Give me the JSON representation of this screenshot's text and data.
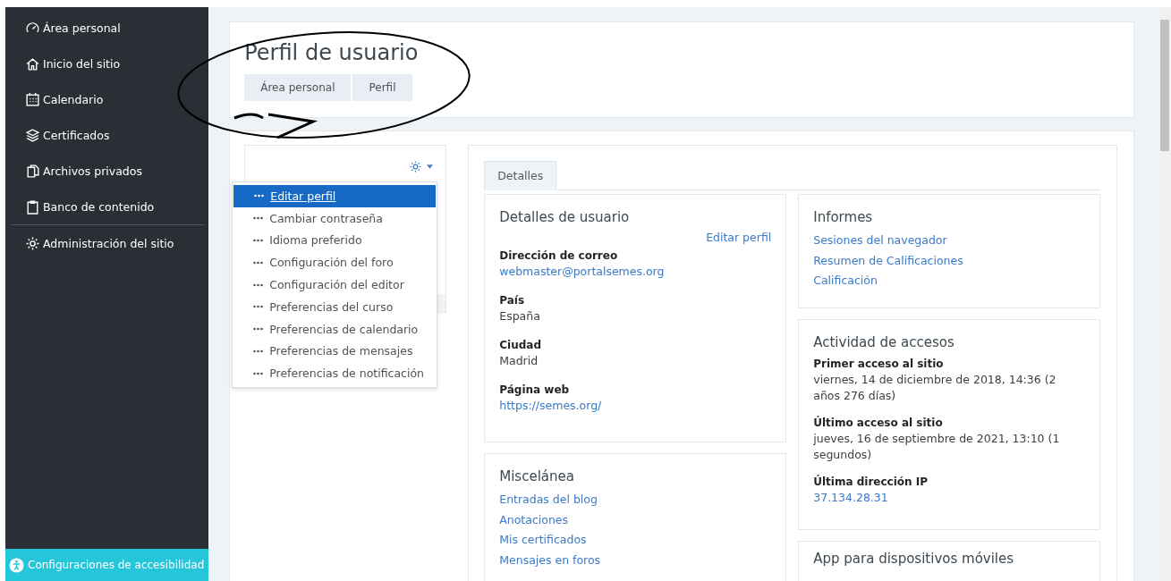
{
  "sidebar": {
    "items": [
      {
        "label": "Área personal"
      },
      {
        "label": "Inicio del sitio"
      },
      {
        "label": "Calendario"
      },
      {
        "label": "Certificados"
      },
      {
        "label": "Archivos privados"
      },
      {
        "label": "Banco de contenido"
      },
      {
        "label": "Administración del sitio"
      }
    ],
    "footer": "Configuraciones de accesibilidad"
  },
  "header": {
    "title": "Perfil de usuario",
    "breadcrumb": [
      "Área personal",
      "Perfil"
    ]
  },
  "menu": [
    {
      "label": "Editar perfil",
      "selected": true
    },
    {
      "label": "Cambiar contraseña",
      "selected": false
    },
    {
      "label": "Idioma preferido",
      "selected": false
    },
    {
      "label": "Configuración del foro",
      "selected": false
    },
    {
      "label": "Configuración del editor",
      "selected": false
    },
    {
      "label": "Preferencias del curso",
      "selected": false
    },
    {
      "label": "Preferencias de calendario",
      "selected": false
    },
    {
      "label": "Preferencias de mensajes",
      "selected": false
    },
    {
      "label": "Preferencias de notificación",
      "selected": false
    }
  ],
  "tabs": [
    {
      "label": "Detalles",
      "selected": true
    }
  ],
  "user_details": {
    "title": "Detalles de usuario",
    "edit_link": "Editar perfil",
    "fields": [
      {
        "label": "Dirección de correo",
        "value": "webmaster@portalsemes.org",
        "kind": "link"
      },
      {
        "label": "País",
        "value": "España",
        "kind": "text"
      },
      {
        "label": "Ciudad",
        "value": "Madrid",
        "kind": "text"
      },
      {
        "label": "Página web",
        "value": "https://semes.org/",
        "kind": "link"
      }
    ]
  },
  "misc": {
    "title": "Miscelánea",
    "links": [
      "Entradas del blog",
      "Anotaciones",
      "Mis certificados",
      "Mensajes en foros"
    ]
  },
  "reports": {
    "title": "Informes",
    "links": [
      "Sesiones del navegador",
      "Resumen de Calificaciones",
      "Calificación"
    ]
  },
  "login_activity": {
    "title": "Actividad de accesos",
    "fields": [
      {
        "label": "Primer acceso al sitio",
        "value": "viernes, 14 de diciembre de 2018, 14:36  (2 años 276 días)",
        "kind": "text"
      },
      {
        "label": "Último acceso al sitio",
        "value": "jueves, 16 de septiembre de 2021, 13:10  (1 segundos)",
        "kind": "text"
      },
      {
        "label": "Última dirección IP",
        "value": "37.134.28.31",
        "kind": "link"
      }
    ]
  },
  "mobile": {
    "title": "App para dispositivos móviles"
  }
}
